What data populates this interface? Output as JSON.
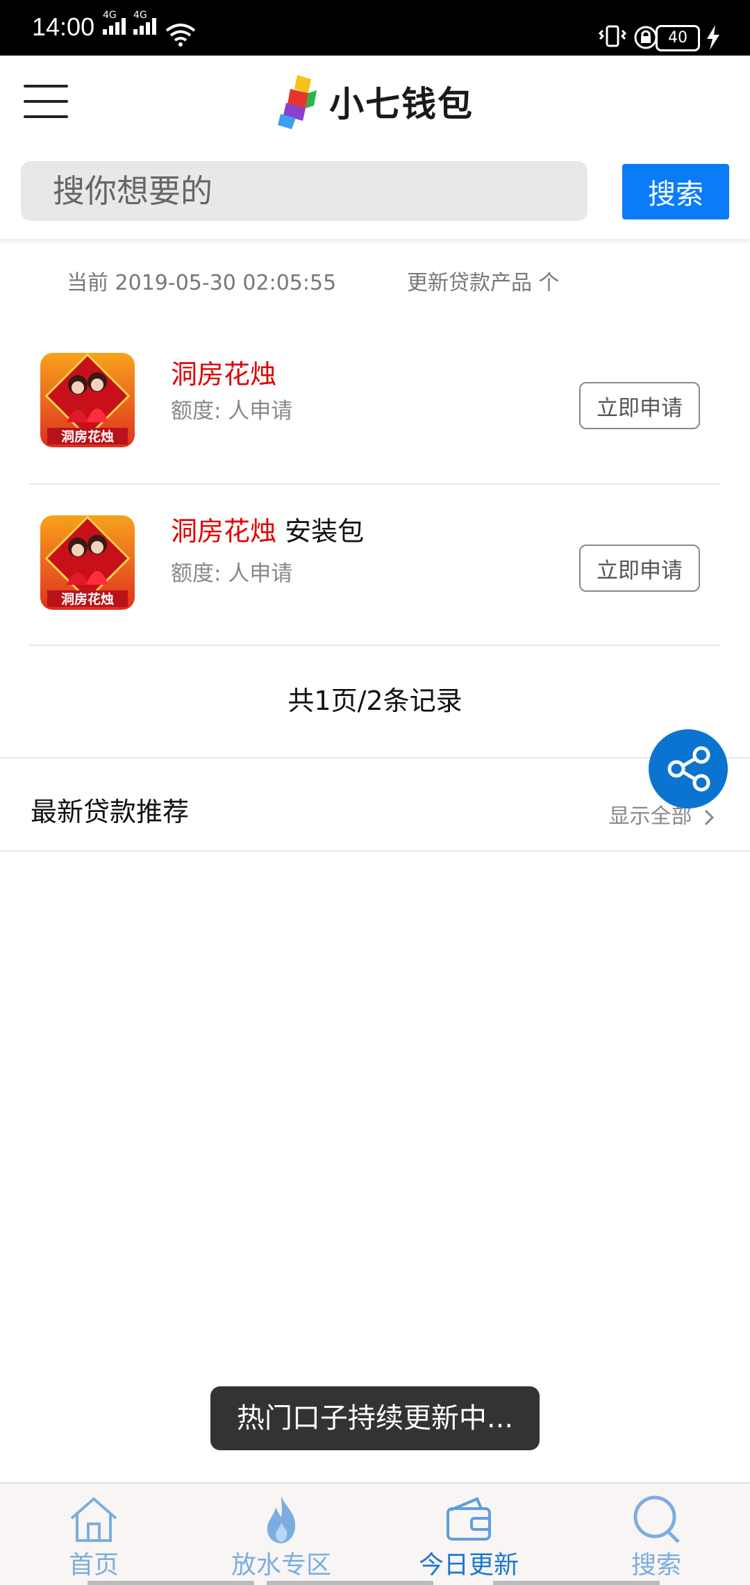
{
  "status_bar": {
    "time": "14:00",
    "battery": "40",
    "network_1": "4G",
    "network_2": "4G"
  },
  "header": {
    "app_name": "小七钱包",
    "search_placeholder": "搜你想要的",
    "search_button": "搜索"
  },
  "info_bar": {
    "current_label": "当前 2019-05-30 02:05:55",
    "update_label": "更新贷款产品 个"
  },
  "products": [
    {
      "name": "洞房花烛",
      "suffix": "",
      "quota": "额度:    人申请",
      "apply": "立即申请"
    },
    {
      "name": "洞房花烛",
      "suffix": "安装包",
      "quota": "额度:    人申请",
      "apply": "立即申请"
    }
  ],
  "thumb_text": "洞房花烛",
  "pagination": "共1页/2条记录",
  "section": {
    "title": "最新贷款推荐",
    "more": "显示全部"
  },
  "toast": "热门口子持续更新中...",
  "tabs": [
    {
      "label": "首页",
      "icon": "home-icon"
    },
    {
      "label": "放水专区",
      "icon": "fire-icon"
    },
    {
      "label": "今日更新",
      "icon": "wallet-icon"
    },
    {
      "label": "搜索",
      "icon": "search-icon"
    }
  ],
  "colors": {
    "accent": "#0a7cf8",
    "product_name": "#e00000",
    "tab_inactive": "#7aaee0",
    "tab_active": "#1a78d0"
  }
}
